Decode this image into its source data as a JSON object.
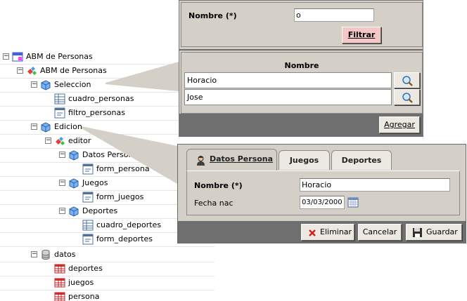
{
  "tree": {
    "items": [
      {
        "label": "ABM de Personas",
        "icon": "window-icon"
      },
      {
        "label": "ABM de Personas",
        "icon": "components-icon"
      },
      {
        "label": "Seleccion",
        "icon": "cube-icon"
      },
      {
        "label": "cuadro_personas",
        "icon": "grid-icon"
      },
      {
        "label": "filtro_personas",
        "icon": "form-icon"
      },
      {
        "label": "Edicion",
        "icon": "cube-icon"
      },
      {
        "label": "editor",
        "icon": "components-icon"
      },
      {
        "label": "Datos Persona",
        "icon": "cube-icon"
      },
      {
        "label": "form_persona",
        "icon": "form-icon"
      },
      {
        "label": "Juegos",
        "icon": "cube-icon"
      },
      {
        "label": "form_juegos",
        "icon": "form-icon"
      },
      {
        "label": "Deportes",
        "icon": "cube-icon"
      },
      {
        "label": "cuadro_deportes",
        "icon": "grid-icon"
      },
      {
        "label": "form_deportes",
        "icon": "form-icon"
      },
      {
        "label": "datos",
        "icon": "database-icon"
      },
      {
        "label": "deportes",
        "icon": "table-icon"
      },
      {
        "label": "juegos",
        "icon": "table-icon"
      },
      {
        "label": "persona",
        "icon": "table-icon"
      }
    ]
  },
  "filter_panel": {
    "name_label": "Nombre (*)",
    "name_value": "o",
    "filter_button": "Filtrar",
    "list_header": "Nombre",
    "rows": [
      "Horacio",
      "Jose"
    ],
    "row_action_icon": "magnifier-icon",
    "add_button": "Agregar"
  },
  "form_panel": {
    "tabs": [
      "Datos Persona",
      "Juegos",
      "Deportes"
    ],
    "tab_icon": "person-icon",
    "name_label": "Nombre (*)",
    "name_value": "Horacio",
    "birth_label": "Fecha nac",
    "birth_value": "03/03/2000",
    "calendar_icon": "calendar-icon",
    "delete_button": "Eliminar",
    "cancel_button": "Cancelar",
    "save_button": "Guardar"
  },
  "colors": {
    "panel_bg": "#d4d0c8",
    "footer_bg": "#6f6f6f",
    "filter_button_bg": "#f6c7c7",
    "callout": "#d4d0c8"
  }
}
